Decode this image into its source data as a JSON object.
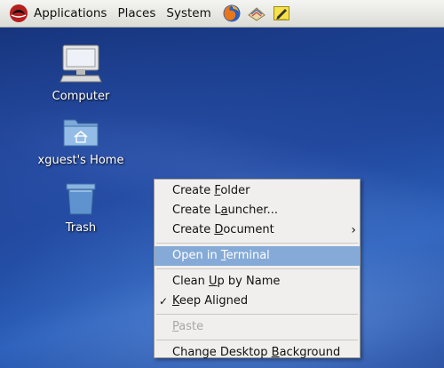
{
  "panel": {
    "menus": [
      "Applications",
      "Places",
      "System"
    ],
    "launchers": [
      "firefox-icon",
      "mail-icon",
      "notes-icon"
    ]
  },
  "desktop": {
    "icons": [
      {
        "label": "Computer",
        "icon": "computer-icon"
      },
      {
        "label": "xguest's Home",
        "icon": "home-folder-icon"
      },
      {
        "label": "Trash",
        "icon": "trash-icon"
      }
    ]
  },
  "context_menu": {
    "create_folder": {
      "pre": "Create ",
      "u": "F",
      "post": "older"
    },
    "create_launcher": {
      "pre": "Create L",
      "u": "a",
      "post": "uncher..."
    },
    "create_document": {
      "pre": "Create ",
      "u": "D",
      "post": "ocument"
    },
    "open_terminal": {
      "pre": "Open in ",
      "u": "T",
      "post": "erminal"
    },
    "clean_up": {
      "pre": "Clean ",
      "u": "U",
      "post": "p by Name"
    },
    "keep_aligned": {
      "pre": "",
      "u": "K",
      "post": "eep Aligned"
    },
    "paste": {
      "pre": "",
      "u": "P",
      "post": "aste"
    },
    "change_bg": {
      "pre": "Change Desktop ",
      "u": "B",
      "post": "ackground"
    },
    "submenu_arrow": "›",
    "check_mark": "✓"
  },
  "colors": {
    "highlight": "#86aad7",
    "wallpaper": "#1f4596"
  }
}
